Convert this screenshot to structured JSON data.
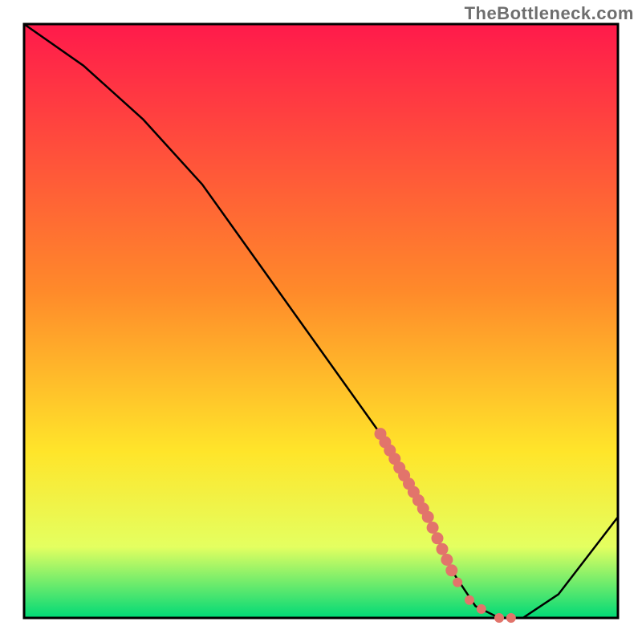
{
  "watermark": "TheBottleneck.com",
  "colors": {
    "gradient_top": "#ff1a4b",
    "gradient_mid1": "#ff8a2a",
    "gradient_mid2": "#ffe52a",
    "gradient_mid3": "#e4ff60",
    "gradient_bottom": "#00d977",
    "frame": "#000000",
    "curve": "#000000",
    "dot": "#e2746b"
  },
  "chart_data": {
    "type": "line",
    "title": "",
    "xlabel": "",
    "ylabel": "",
    "xlim": [
      0,
      100
    ],
    "ylim": [
      0,
      100
    ],
    "grid": false,
    "legend": false,
    "series": [
      {
        "name": "bottleneck-curve",
        "x": [
          0,
          10,
          20,
          30,
          40,
          50,
          60,
          68,
          72,
          76,
          80,
          84,
          90,
          100
        ],
        "y": [
          100,
          93,
          84,
          73,
          59,
          45,
          31,
          17,
          8,
          2,
          0,
          0,
          4,
          17
        ]
      }
    ],
    "highlights": {
      "name": "highlight-dots",
      "points": [
        {
          "x": 60.0,
          "y": 31.0
        },
        {
          "x": 60.8,
          "y": 29.6
        },
        {
          "x": 61.6,
          "y": 28.2
        },
        {
          "x": 62.4,
          "y": 26.8
        },
        {
          "x": 63.2,
          "y": 25.3
        },
        {
          "x": 64.0,
          "y": 24.0
        },
        {
          "x": 64.8,
          "y": 22.6
        },
        {
          "x": 65.6,
          "y": 21.2
        },
        {
          "x": 66.4,
          "y": 19.8
        },
        {
          "x": 67.2,
          "y": 18.4
        },
        {
          "x": 68.0,
          "y": 17.0
        },
        {
          "x": 68.8,
          "y": 15.2
        },
        {
          "x": 69.6,
          "y": 13.4
        },
        {
          "x": 70.4,
          "y": 11.6
        },
        {
          "x": 71.2,
          "y": 9.8
        },
        {
          "x": 72.0,
          "y": 8.0
        },
        {
          "x": 73.0,
          "y": 6.0
        },
        {
          "x": 75.0,
          "y": 3.0
        },
        {
          "x": 77.0,
          "y": 1.5
        },
        {
          "x": 80.0,
          "y": 0.0
        },
        {
          "x": 82.0,
          "y": 0.0
        }
      ]
    }
  }
}
